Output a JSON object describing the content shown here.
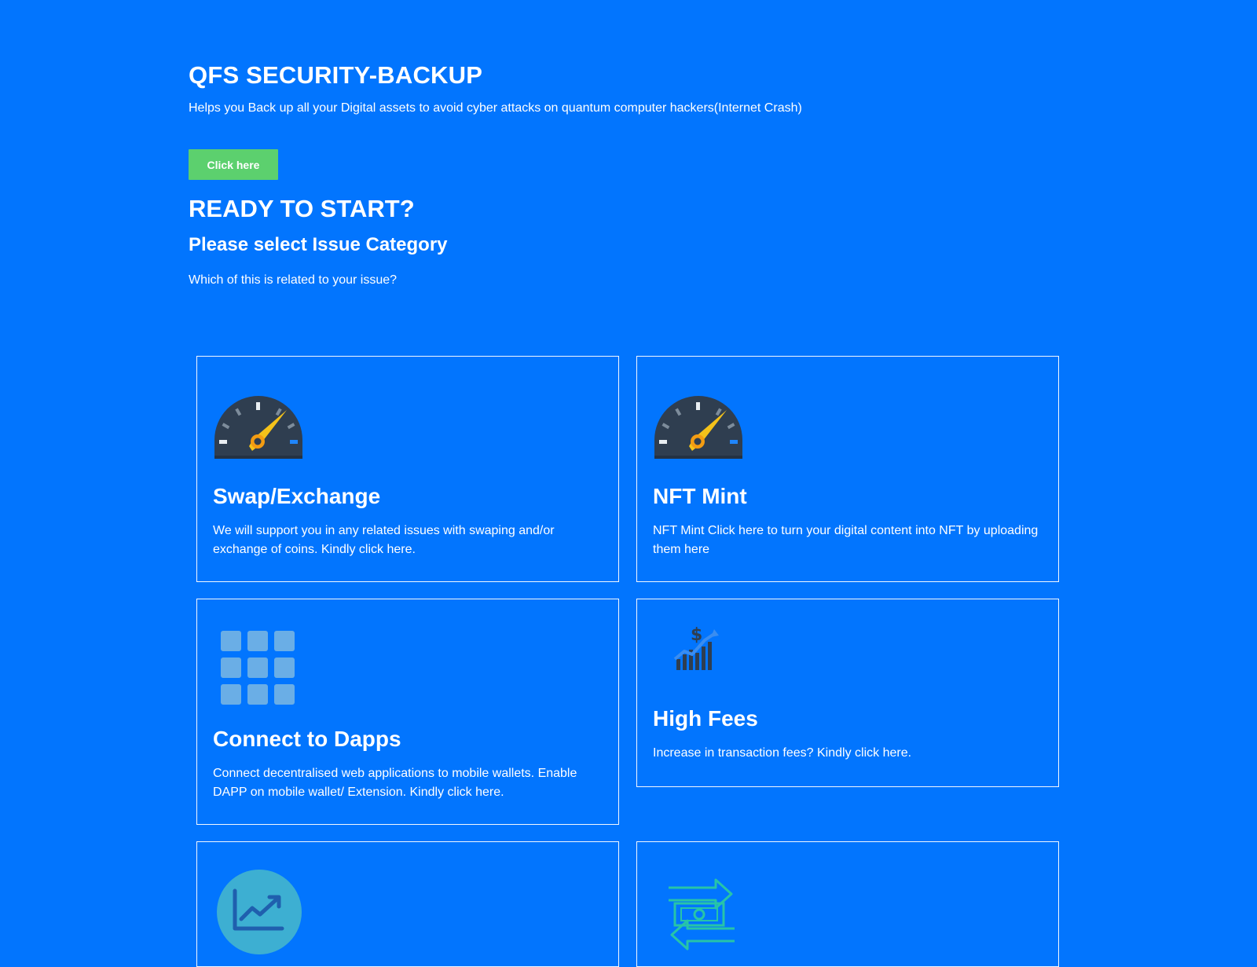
{
  "hero": {
    "title": "QFS SECURITY-BACKUP",
    "subtitle": "Helps you Back up all your Digital assets to avoid cyber attacks on quantum computer hackers(Internet Crash)",
    "button_label": "Click here"
  },
  "ready": {
    "title": "READY TO START?",
    "category_title": "Please select Issue Category",
    "question": "Which of this is related to your issue?"
  },
  "cards": [
    {
      "title": "Swap/Exchange",
      "description": "We will support you in any related issues with swaping and/or exchange of coins. Kindly click here.",
      "icon": "speedometer-icon"
    },
    {
      "title": "NFT Mint",
      "description": "NFT Mint Click here to turn your digital content into NFT by uploading them here",
      "icon": "speedometer-icon"
    },
    {
      "title": "Connect to Dapps",
      "description": "Connect decentralised web applications to mobile wallets. Enable DAPP on mobile wallet/ Extension. Kindly click here.",
      "icon": "apps-grid-icon"
    },
    {
      "title": "High Fees",
      "description": "Increase in transaction fees? Kindly click here.",
      "icon": "dollar-chart-icon"
    },
    {
      "title": "",
      "description": "",
      "icon": "trend-chart-icon"
    },
    {
      "title": "",
      "description": "",
      "icon": "money-transfer-icon"
    }
  ],
  "colors": {
    "background": "#0275fe",
    "cta": "#5cd06e",
    "gauge_dark": "#2f3e50",
    "gauge_needle": "#f4c21a"
  }
}
